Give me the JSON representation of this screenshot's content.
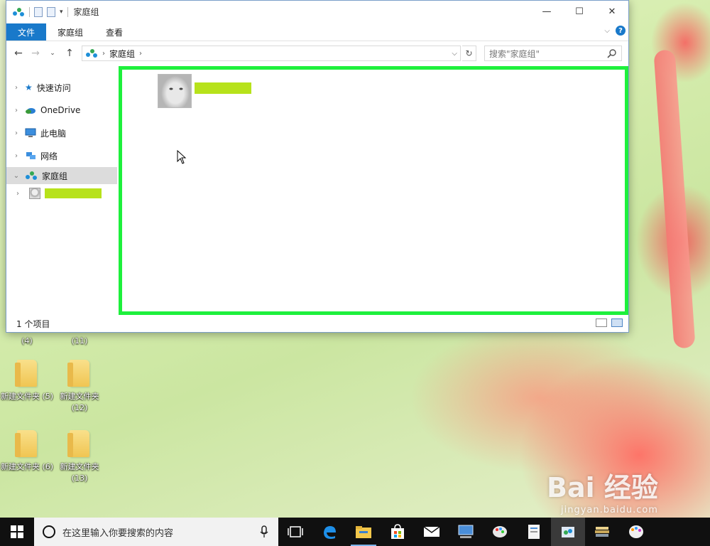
{
  "window": {
    "title": "家庭组",
    "ribbon_tabs": [
      "文件",
      "家庭组",
      "查看"
    ],
    "address": {
      "crumb": "家庭组"
    },
    "search_placeholder": "搜索\"家庭组\"",
    "status": "1 个项目"
  },
  "navigation": {
    "items": [
      {
        "label": "快速访问",
        "icon": "star-icon"
      },
      {
        "label": "OneDrive",
        "icon": "cloud-icon"
      },
      {
        "label": "此电脑",
        "icon": "computer-icon"
      },
      {
        "label": "网络",
        "icon": "network-icon"
      },
      {
        "label": "家庭组",
        "icon": "homegroup-icon"
      }
    ]
  },
  "desktop": {
    "icons": [
      {
        "label": "(4)"
      },
      {
        "label": "(11)"
      },
      {
        "label": "新建文件夹 (5)"
      },
      {
        "label": "新建文件夹 (12)"
      },
      {
        "label": "新建文件夹 (6)"
      },
      {
        "label": "新建文件夹 (13)"
      }
    ]
  },
  "taskbar": {
    "search_placeholder": "在这里输入你要搜索的内容"
  },
  "watermark": {
    "brand": "Bai 经验",
    "url": "jingyan.baidu.com"
  },
  "colors": {
    "highlight_border": "#1ef03c",
    "redaction": "#b7e21b",
    "accent": "#1979ca"
  }
}
